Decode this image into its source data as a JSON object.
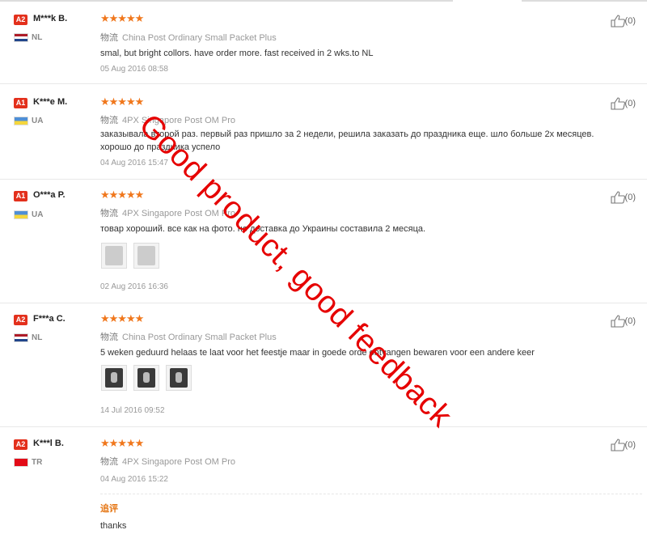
{
  "helpful_label": "(0)",
  "ship_prefix": "物流",
  "reviews": [
    {
      "level": "A2",
      "user": "M***k B.",
      "country": "NL",
      "shipping": "China Post Ordinary Small Packet Plus",
      "text": "smal, but bright collors. have order more. fast received in 2 wks.to NL",
      "date": "05 Aug 2016 08:58"
    },
    {
      "level": "A1",
      "user": "K***e M.",
      "country": "UA",
      "shipping": "4PX Singapore Post OM Pro",
      "text": "заказывала второй раз. первый раз пришло за 2 недели, решила заказать до праздника еще. шло больше 2х месяцев. хорошо до праздника успело",
      "date": "04 Aug 2016 15:47"
    },
    {
      "level": "A1",
      "user": "O***a P.",
      "country": "UA",
      "shipping": "4PX Singapore Post OM Pro",
      "text": "товар хороший. все как на фото. но доставка до Украины составила 2 месяца.",
      "date": "02 Aug 2016 16:36"
    },
    {
      "level": "A2",
      "user": "F***a C.",
      "country": "NL",
      "shipping": "China Post Ordinary Small Packet Plus",
      "text": "5 weken geduurd helaas te laat voor het feestje maar in goede orde ontvangen bewaren voor een andere keer",
      "date": "14 Jul 2016 09:52"
    },
    {
      "level": "A2",
      "user": "K***l B.",
      "country": "TR",
      "shipping": "4PX Singapore Post OM Pro",
      "text": "",
      "date": "04 Aug 2016 15:22",
      "additional_label": "追评",
      "additional_text": "thanks"
    }
  ],
  "watermark": "Good product, good feedback",
  "colors": {
    "badge": "#e3301c",
    "stars": "#f0771c",
    "watermark": "#e60000",
    "additional": "#e4730f"
  }
}
